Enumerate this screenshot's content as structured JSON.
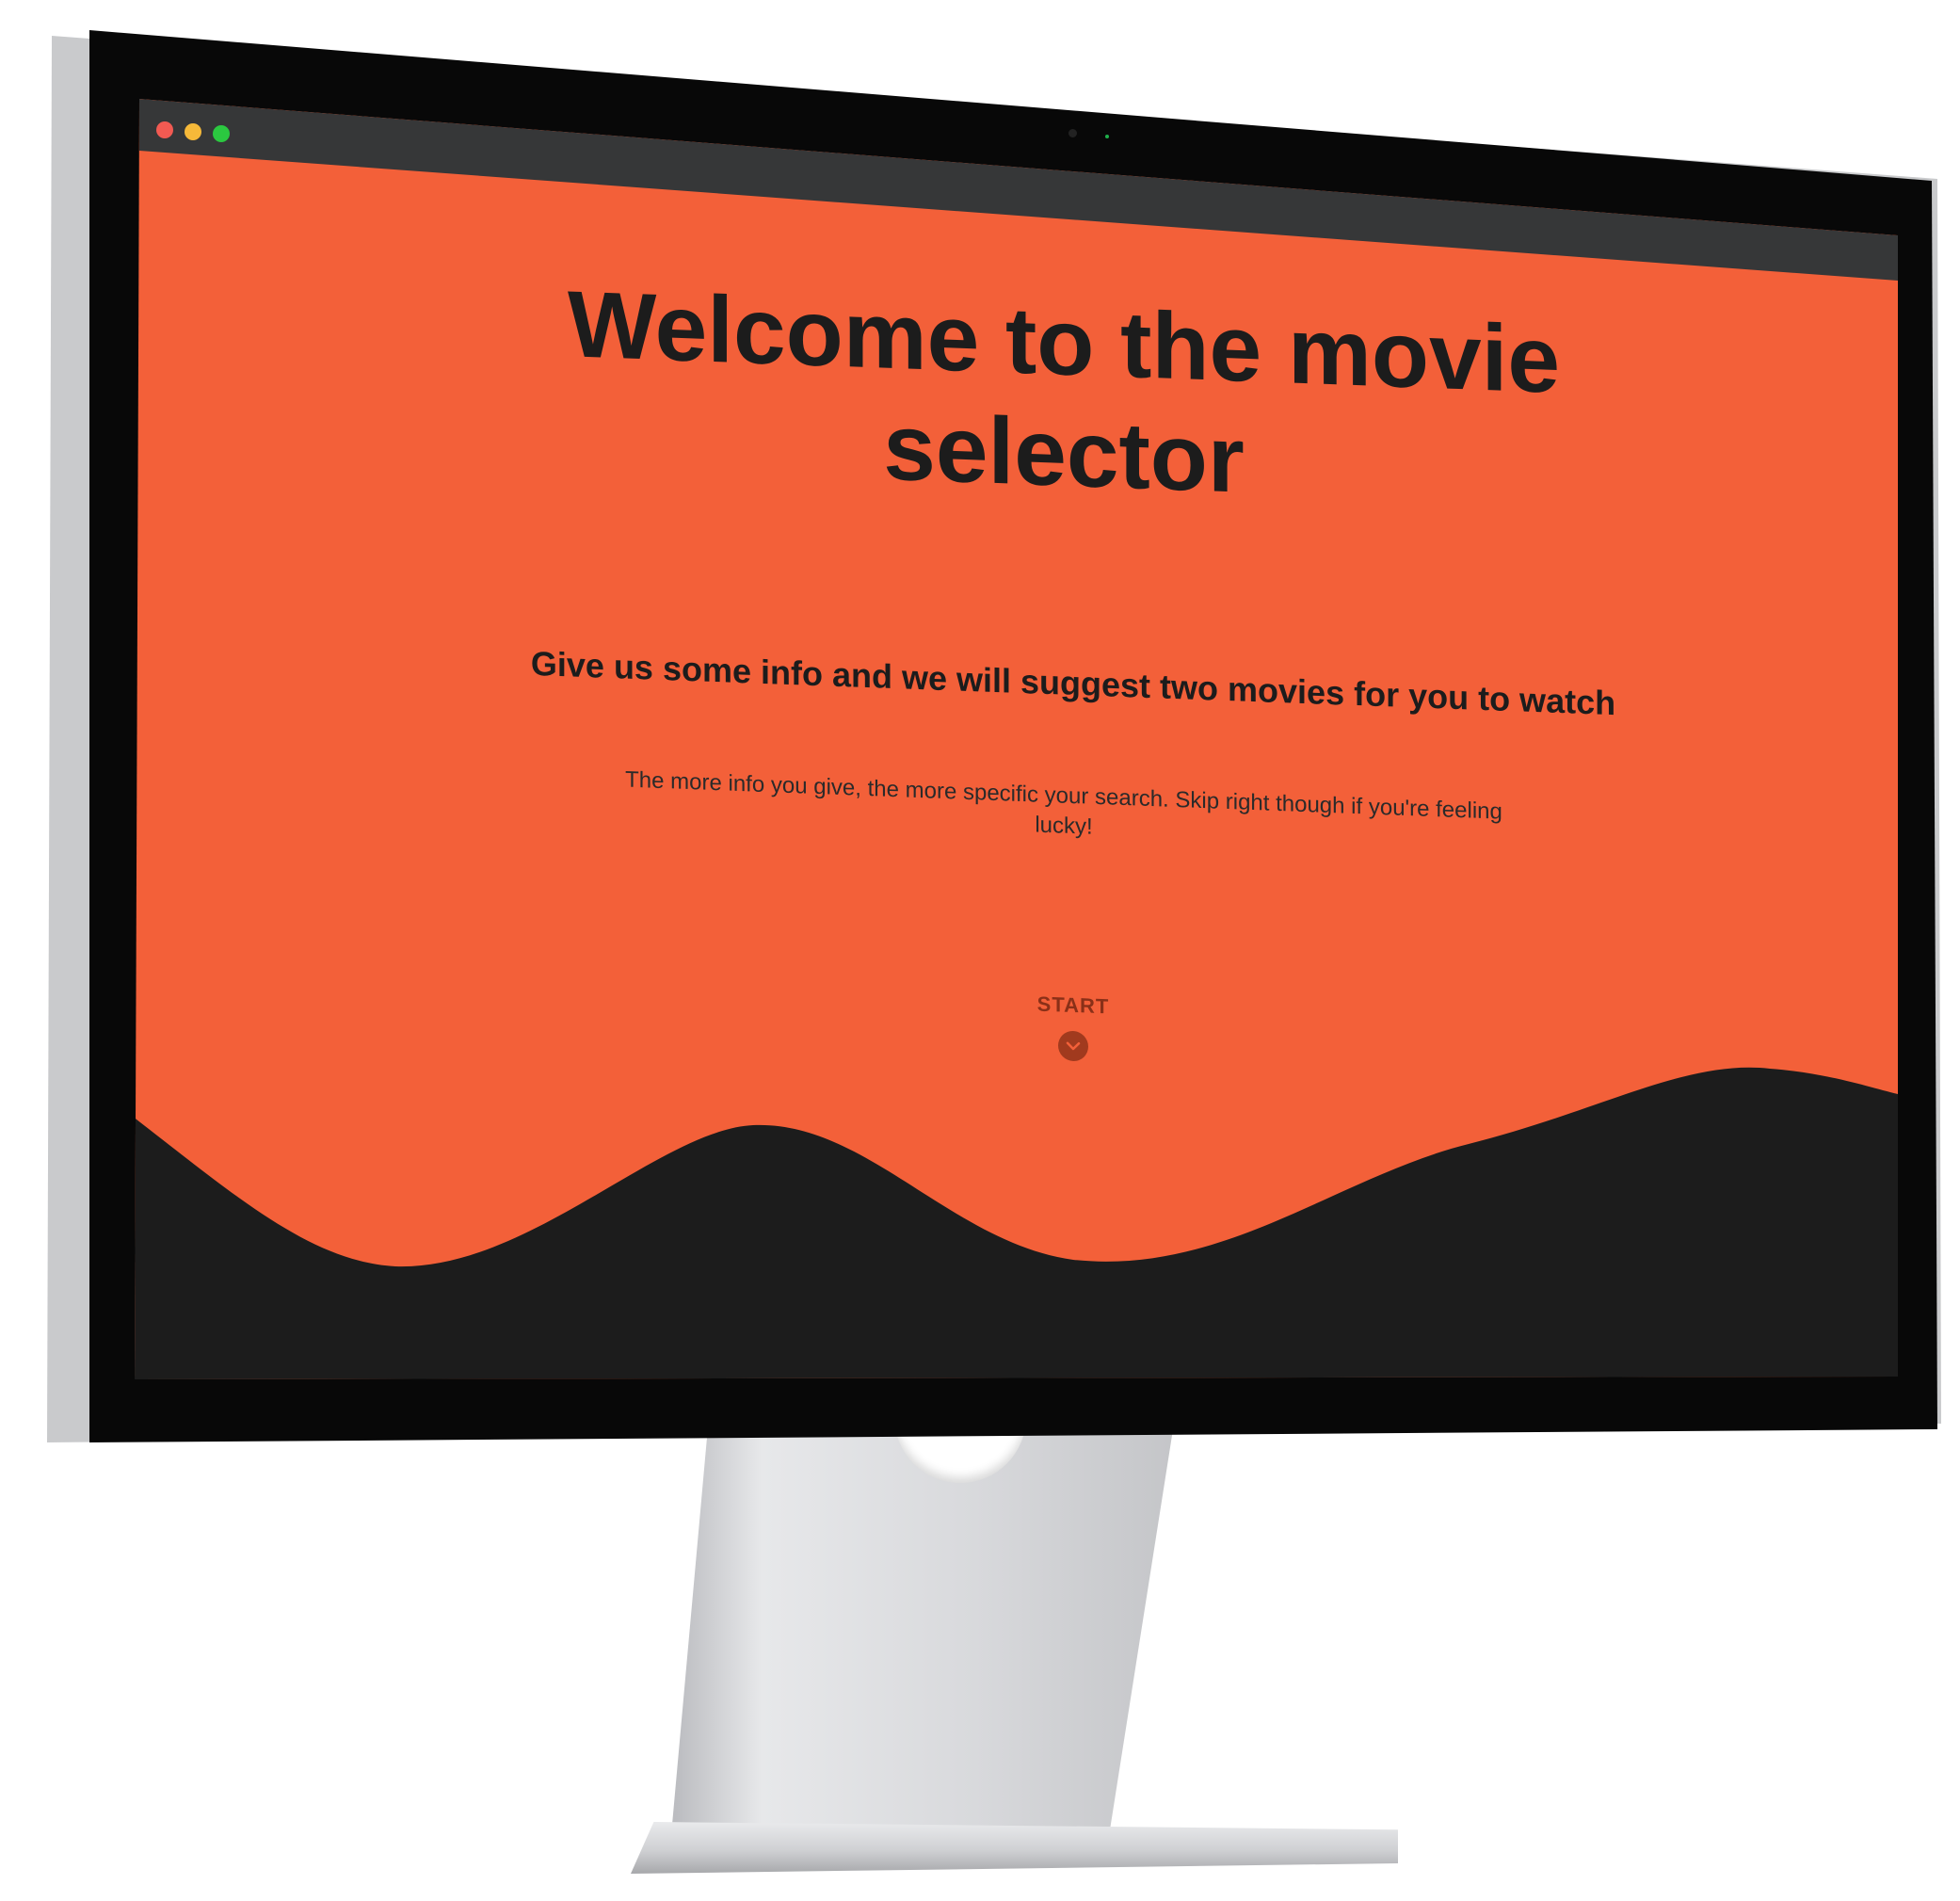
{
  "colors": {
    "page_bg": "#f36039",
    "wave": "#1c1c1c",
    "text": "#1c1c1c",
    "titlebar": "#363738",
    "start_icon": "#a13a1e"
  },
  "window": {
    "controls": [
      "close",
      "minimize",
      "zoom"
    ]
  },
  "hero": {
    "title": "Welcome to the movie selector",
    "subtitle": "Give us some info and we will suggest two movies for you to watch",
    "description": "The more info you give, the more specific your search. Skip right though if you're feeling lucky!",
    "start_label": "START",
    "start_icon": "chevron-down-icon"
  }
}
